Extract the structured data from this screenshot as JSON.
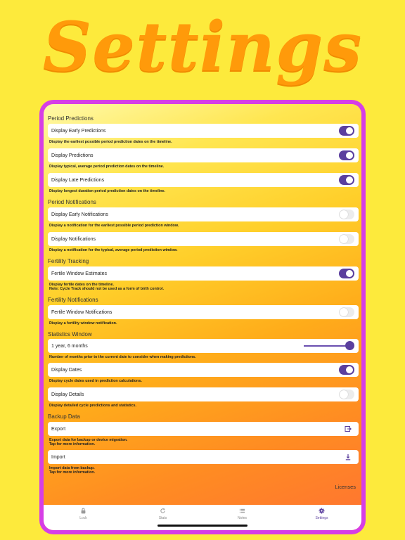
{
  "hero": {
    "title": "Settings"
  },
  "sections": {
    "period_predictions": "Period Predictions",
    "period_notifications": "Period Notifications",
    "fertility_tracking": "Fertility Tracking",
    "fertility_notifications": "Fertility Notifications",
    "statistics_window": "Statistics Window",
    "backup_data": "Backup Data"
  },
  "rows": {
    "early_predictions": {
      "label": "Display Early Predictions",
      "desc": "Display the earliest possible period prediction dates on the timeline.",
      "on": true
    },
    "predictions": {
      "label": "Display Predictions",
      "desc": "Display typical, average period prediction dates on the timeline.",
      "on": true
    },
    "late_predictions": {
      "label": "Display Late Predictions",
      "desc": "Display longest duration period prediction dates on the timeline.",
      "on": true
    },
    "early_notifications": {
      "label": "Display Early Notifications",
      "desc": "Display a notification for the earliest possible period prediction window.",
      "on": false
    },
    "notifications": {
      "label": "Display Notifications",
      "desc": "Display a notification for the typical, average period prediction window.",
      "on": false
    },
    "fertile_estimates": {
      "label": "Fertile Window Estimates",
      "desc1": "Display fertile dates on the timeline.",
      "desc2": "Note: Cycle Track should not be used as a form of birth control.",
      "on": true
    },
    "fertile_notifications": {
      "label": "Fertile Window Notifications",
      "desc": "Display a fertility window notification.",
      "on": false
    },
    "statistics_window": {
      "label": "1 year, 6 months",
      "desc": "Number of months prior to the current date to consider when making predictions.",
      "slider_fraction": 1.0
    },
    "display_dates": {
      "label": "Display Dates",
      "desc": "Display cycle dates used in prediction calculations.",
      "on": true
    },
    "display_details": {
      "label": "Display Details",
      "desc": "Display detailed cycle predictions and statistics.",
      "on": false
    },
    "export": {
      "label": "Export",
      "desc1": "Export data for backup or device migration.",
      "desc2": "Tap for more information."
    },
    "import": {
      "label": "Import",
      "desc1": "Import data from backup.",
      "desc2": "Tap for more information."
    }
  },
  "licenses": "Licenses",
  "tabbar": {
    "items": [
      {
        "label": "Lock",
        "icon": "lock-icon"
      },
      {
        "label": "Stats",
        "icon": "refresh-icon"
      },
      {
        "label": "Notes",
        "icon": "list-icon"
      },
      {
        "label": "Settings",
        "icon": "gear-icon",
        "active": true
      }
    ]
  },
  "colors": {
    "background": "#fdea3c",
    "hero_title": "#ff9a0a",
    "device_frame": "#d63ee6",
    "toggle_on": "#5b3f9e",
    "toggle_off": "#ececec"
  }
}
